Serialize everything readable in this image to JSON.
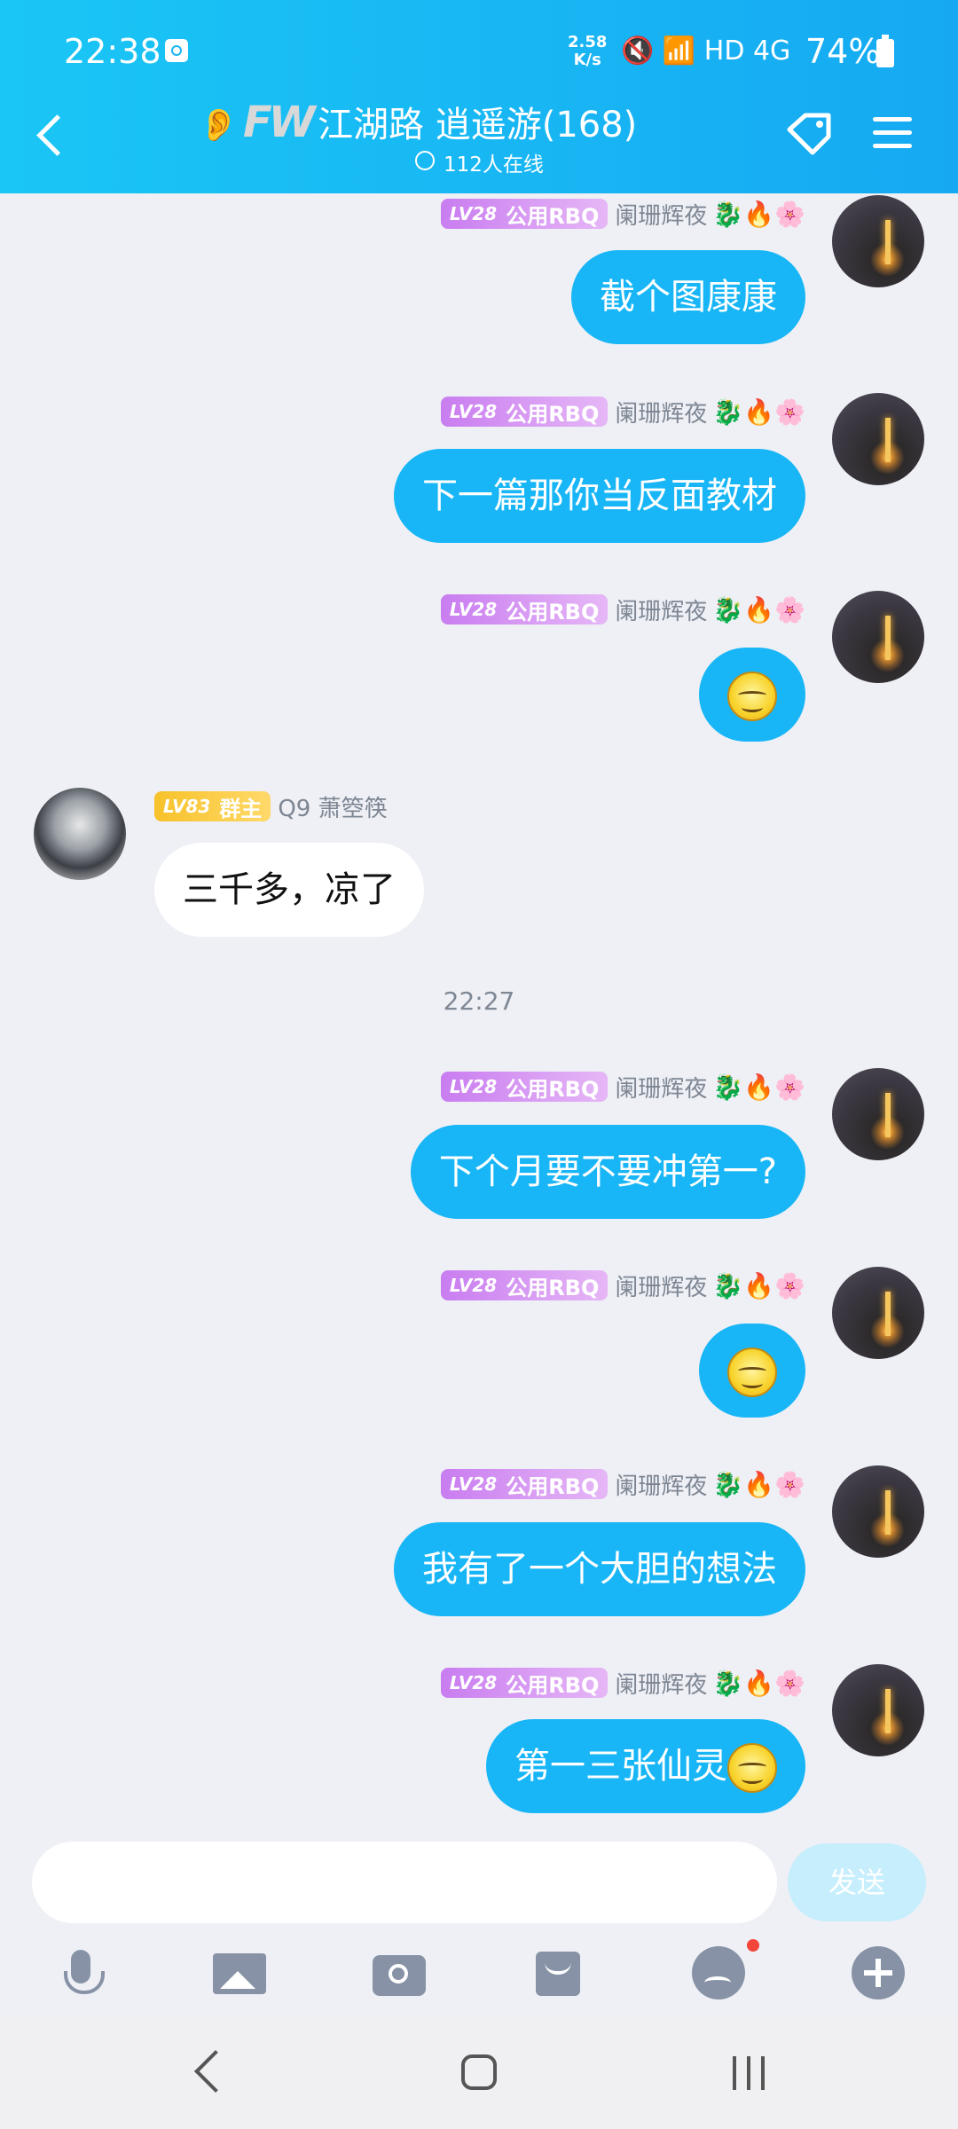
{
  "status_bar": {
    "time": "22:38",
    "net_speed_value": "2.58",
    "net_speed_unit": "K/s",
    "icons": "🔇 📶 HD 4G",
    "battery": "74%"
  },
  "header": {
    "logo": "FW",
    "title": "江湖路 逍遥游(168)",
    "online": "112人在线"
  },
  "messages": [
    {
      "side": "right",
      "level": "LV28",
      "title": "公用RBQ",
      "name": "阑珊辉夜",
      "text": "截个图康康"
    },
    {
      "side": "right",
      "level": "LV28",
      "title": "公用RBQ",
      "name": "阑珊辉夜",
      "text": "下一篇那你当反面教材"
    },
    {
      "side": "right",
      "level": "LV28",
      "title": "公用RBQ",
      "name": "阑珊辉夜",
      "text": "",
      "emoji": "smirk-emoji"
    },
    {
      "side": "left",
      "level": "LV83",
      "title": "群主",
      "name": "Q9 萧箜筷",
      "text": "三千多，凉了"
    },
    {
      "side": "right",
      "level": "LV28",
      "title": "公用RBQ",
      "name": "阑珊辉夜",
      "text": "下个月要不要冲第一?"
    },
    {
      "side": "right",
      "level": "LV28",
      "title": "公用RBQ",
      "name": "阑珊辉夜",
      "text": "",
      "emoji": "smirk-emoji"
    },
    {
      "side": "right",
      "level": "LV28",
      "title": "公用RBQ",
      "name": "阑珊辉夜",
      "text": "我有了一个大胆的想法"
    },
    {
      "side": "right",
      "level": "LV28",
      "title": "公用RBQ",
      "name": "阑珊辉夜",
      "text": "第一三张仙灵",
      "emoji": "smirk-emoji"
    }
  ],
  "timestamp": "22:27",
  "input": {
    "send_label": "发送",
    "placeholder": ""
  },
  "toolbar": [
    "mic-icon",
    "image-icon",
    "camera-icon",
    "red-packet-icon",
    "emoji-icon",
    "plus-icon"
  ],
  "deco": "🐉🔥🌸",
  "colors": {
    "accent": "#18b6f6",
    "badge": "#c97df0",
    "owner_badge": "#f7c22a"
  }
}
